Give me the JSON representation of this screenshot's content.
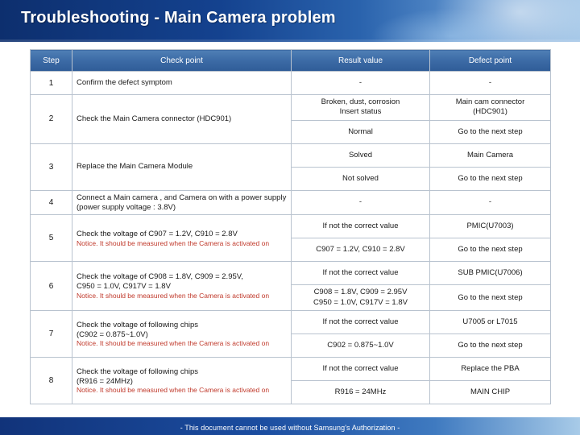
{
  "header": {
    "title": "Troubleshooting - Main Camera problem"
  },
  "table": {
    "columns": [
      "Step",
      "Check point",
      "Result value",
      "Defect point"
    ],
    "rows": [
      {
        "step": "1",
        "checkpoint": "Confirm the defect symptom",
        "results": [
          "-"
        ],
        "defects": [
          "-"
        ]
      },
      {
        "step": "2",
        "checkpoint": "Check the Main Camera connector (HDC901)",
        "results": [
          "Broken, dust, corrosion\nInsert status",
          "Normal"
        ],
        "defects": [
          "Main cam connector\n(HDC901)",
          "Go to the next step"
        ]
      },
      {
        "step": "3",
        "checkpoint": "Replace the Main Camera Module",
        "results": [
          "Solved",
          "Not solved"
        ],
        "defects": [
          "Main Camera",
          "Go to the next step"
        ]
      },
      {
        "step": "4",
        "checkpoint": "Connect a Main camera , and Camera on with a power supply\n(power supply voltage : 3.8V)",
        "results": [
          "-"
        ],
        "defects": [
          "-"
        ]
      },
      {
        "step": "5",
        "checkpoint": "Check the voltage of C907 = 1.2V, C910 = 2.8V",
        "notice": "Notice. It should be measured when the Camera is activated on",
        "results": [
          "If not the correct value",
          "C907 = 1.2V, C910 = 2.8V"
        ],
        "defects": [
          "PMIC(U7003)",
          "Go to the next step"
        ]
      },
      {
        "step": "6",
        "checkpoint": "Check the voltage of C908 = 1.8V, C909 = 2.95V,\nC950 = 1.0V, C917V = 1.8V",
        "notice": "Notice. It should be measured when the Camera is activated on",
        "results": [
          "If not the correct value",
          "C908 = 1.8V, C909 = 2.95V\nC950 = 1.0V, C917V = 1.8V"
        ],
        "defects": [
          "SUB PMIC(U7006)",
          "Go to the next step"
        ]
      },
      {
        "step": "7",
        "checkpoint": "Check the voltage of following chips\n(C902 = 0.875~1.0V)",
        "notice": "Notice. It should be measured when the Camera is activated on",
        "results": [
          "If not the correct value",
          "C902 = 0.875~1.0V"
        ],
        "defects": [
          "U7005 or L7015",
          "Go to the next step"
        ]
      },
      {
        "step": "8",
        "checkpoint": "Check the voltage of following chips\n(R916 = 24MHz)",
        "notice": "Notice. It should be measured when the Camera is activated on",
        "results": [
          "If not the correct value",
          "R916 = 24MHz"
        ],
        "defects": [
          "Replace the PBA",
          "MAIN CHIP"
        ]
      }
    ]
  },
  "footer": {
    "text": "- This document cannot be used without Samsung's Authorization -"
  }
}
